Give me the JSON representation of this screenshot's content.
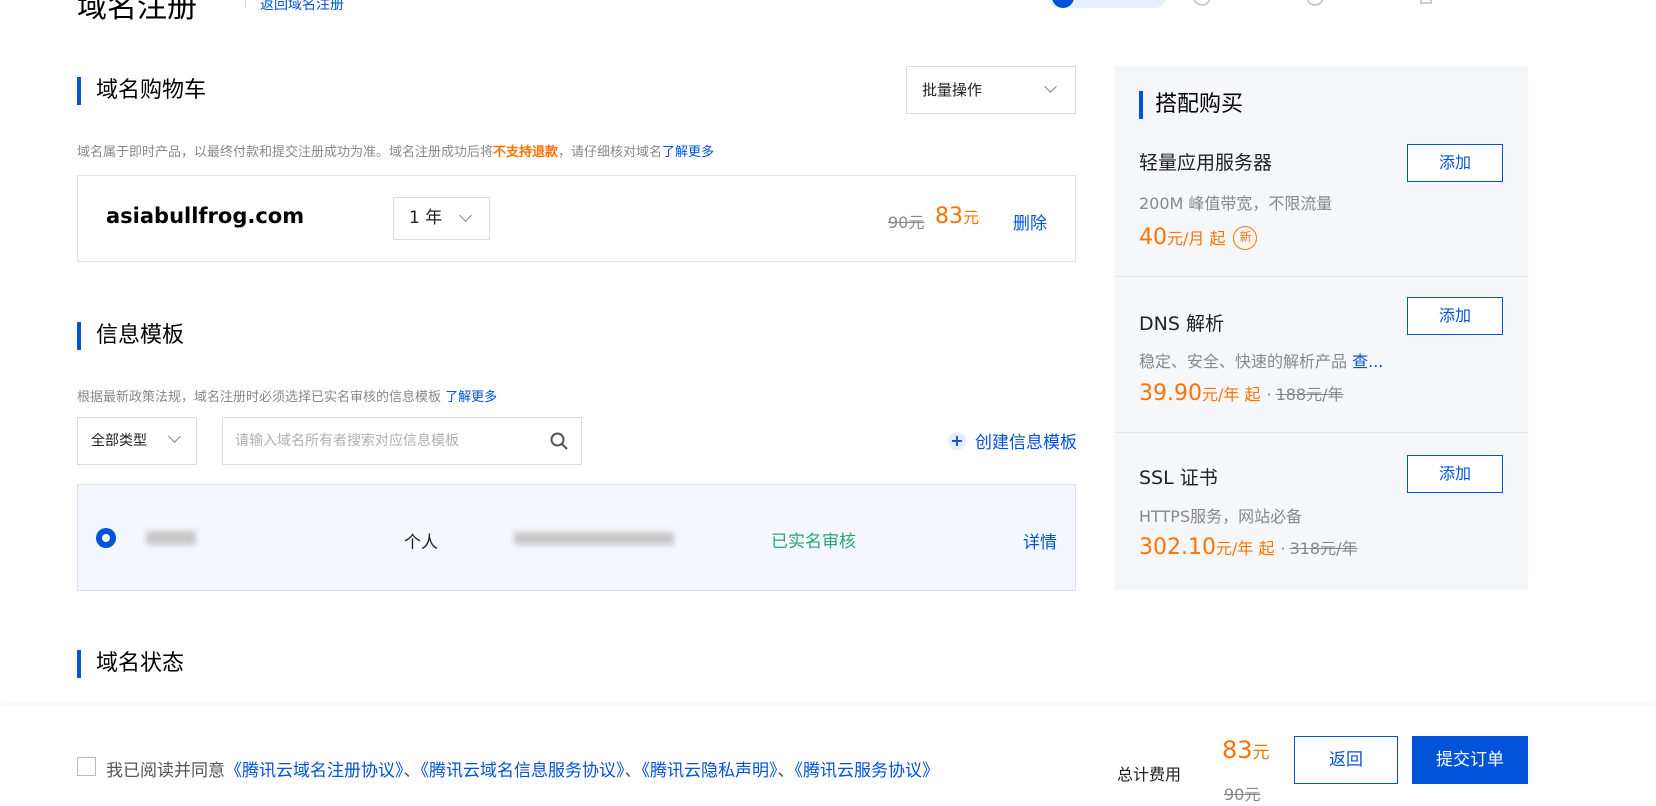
{
  "header": {
    "title": "域名注册",
    "back_link": "返回域名注册"
  },
  "cart": {
    "heading": "域名购物车",
    "batch_label": "批量操作",
    "note_prefix": "域名属于即时产品，以最终付款和提交注册成功为准。域名注册成功后将",
    "note_warning": "不支持退款",
    "note_suffix": "，请仔细核对域名",
    "note_link": "了解更多",
    "item": {
      "domain": "asiabullfrog.com",
      "period": "1 年",
      "original_price": "90元",
      "price_value": "83",
      "price_unit": "元",
      "delete_label": "删除"
    }
  },
  "template": {
    "heading": "信息模板",
    "note": "根据最新政策法规，域名注册时必须选择已实名审核的信息模板",
    "note_link": "了解更多",
    "type_filter": "全部类型",
    "search_placeholder": "请输入域名所有者搜索对应信息模板",
    "create_label": "创建信息模板",
    "row": {
      "owner_type": "个人",
      "status": "已实名审核",
      "detail_label": "详情"
    }
  },
  "status_section": {
    "heading": "域名状态"
  },
  "side": {
    "heading": "搭配购买",
    "items": [
      {
        "name": "轻量应用服务器",
        "desc": "200M 峰值带宽，不限流量",
        "price": "40",
        "unit": "元/月 起",
        "badge": "新",
        "add_label": "添加"
      },
      {
        "name": "DNS 解析",
        "desc": "稳定、安全、快速的解析产品",
        "desc_link": "查...",
        "price": "39.90",
        "unit": "元/年 起",
        "separator": "·",
        "original": "188元/年",
        "add_label": "添加"
      },
      {
        "name": "SSL 证书",
        "desc": "HTTPS服务，网站必备",
        "price": "302.10",
        "unit": "元/年 起",
        "separator": "·",
        "original": "318元/年",
        "add_label": "添加"
      }
    ]
  },
  "footer": {
    "agree_prefix": "我已阅读并同意",
    "agreements": [
      "《腾讯云域名注册协议》",
      "《腾讯云域名信息服务协议》",
      "《腾讯云隐私声明》",
      "《腾讯云服务协议》"
    ],
    "sep": "、",
    "total_label": "总计费用",
    "total_value": "83",
    "total_unit": "元",
    "total_original": "90元",
    "back_label": "返回",
    "submit_label": "提交订单"
  },
  "colors": {
    "accent": "#0052d9",
    "price": "#ff7200",
    "verified": "#2ba471"
  }
}
